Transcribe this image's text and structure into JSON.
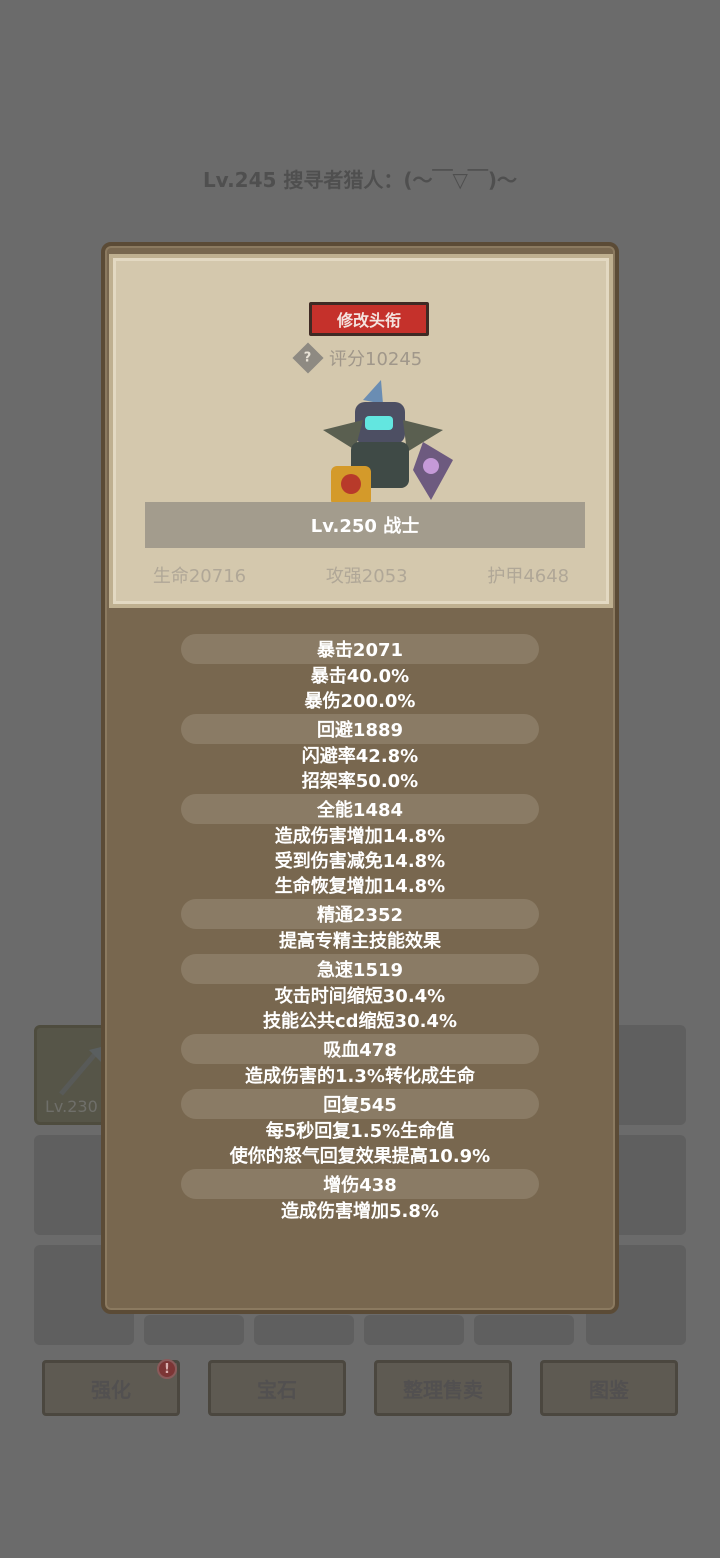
{
  "page": {
    "title": "Lv.245 搜寻者猎人：(～￣▽￣)～"
  },
  "background": {
    "item_level": "Lv.230",
    "buttons": [
      {
        "label": "强化",
        "badge": "!"
      },
      {
        "label": "宝石"
      },
      {
        "label": "整理售卖"
      },
      {
        "label": "图鉴"
      }
    ]
  },
  "panel": {
    "rename_label": "修改头衔",
    "score_label": "评分10245",
    "level_label": "Lv.250 战士",
    "stats": {
      "hp": "生命20716",
      "attack": "攻强2053",
      "armor": "护甲4648"
    },
    "attributes": [
      {
        "title": "暴击2071",
        "lines": [
          "暴击40.0%",
          "暴伤200.0%"
        ]
      },
      {
        "title": "回避1889",
        "lines": [
          "闪避率42.8%",
          "招架率50.0%"
        ]
      },
      {
        "title": "全能1484",
        "lines": [
          "造成伤害增加14.8%",
          "受到伤害减免14.8%",
          "生命恢复增加14.8%"
        ]
      },
      {
        "title": "精通2352",
        "lines": [
          "提高专精主技能效果"
        ]
      },
      {
        "title": "急速1519",
        "lines": [
          "攻击时间缩短30.4%",
          "技能公共cd缩短30.4%"
        ]
      },
      {
        "title": "吸血478",
        "lines": [
          "造成伤害的1.3%转化成生命"
        ]
      },
      {
        "title": "回复545",
        "lines": [
          "每5秒回复1.5%生命值",
          "使你的怒气回复效果提高10.9%"
        ]
      },
      {
        "title": "增伤438",
        "lines": [
          "造成伤害增加5.8%"
        ]
      }
    ]
  },
  "colors": {
    "backdrop": "#6b6b6b",
    "panel": "#78674f",
    "card": "#d4c8ad",
    "rename_button": "#c5312b"
  },
  "icons": {
    "help": "help-icon",
    "hero": "warrior-hero-icon",
    "item": "axe-icon"
  }
}
